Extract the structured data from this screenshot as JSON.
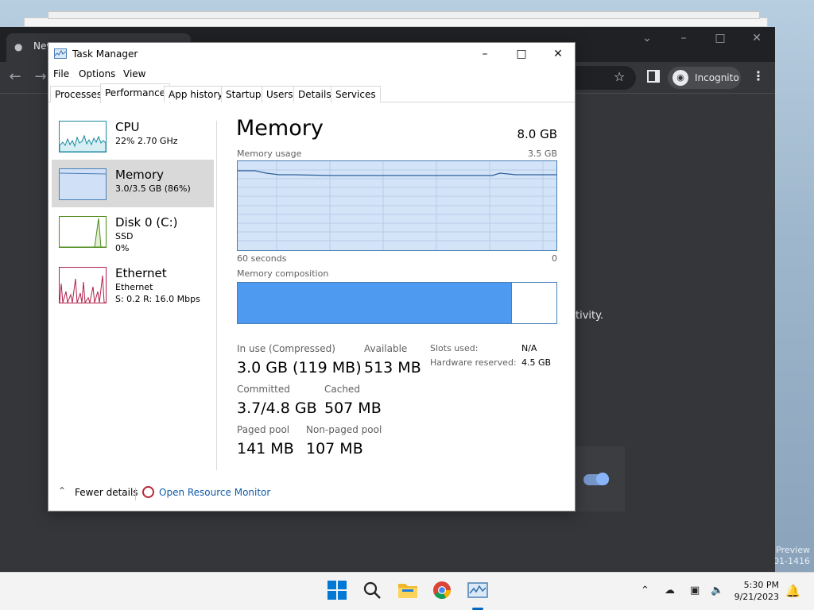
{
  "desktop": {
    "watermark_line1": "Preview",
    "watermark_line2": "001-1416"
  },
  "chrome": {
    "tab_title": "New",
    "incognito_label": "Incognito",
    "page_text_fragment": "tivity."
  },
  "task_manager": {
    "window_title": "Task Manager",
    "menu": [
      "File",
      "Options",
      "View"
    ],
    "tabs": [
      "Processes",
      "Performance",
      "App history",
      "Startup",
      "Users",
      "Details",
      "Services"
    ],
    "active_tab": "Performance",
    "resources": [
      {
        "name": "CPU",
        "line1": "22%  2.70 GHz",
        "line2": ""
      },
      {
        "name": "Memory",
        "line1": "3.0/3.5 GB (86%)",
        "line2": ""
      },
      {
        "name": "Disk 0 (C:)",
        "line1": "SSD",
        "line2": "0%"
      },
      {
        "name": "Ethernet",
        "line1": "Ethernet",
        "line2": "S: 0.2  R: 16.0 Mbps"
      }
    ],
    "memory": {
      "title": "Memory",
      "total": "8.0 GB",
      "usage_label": "Memory usage",
      "usage_max": "3.5 GB",
      "time_left": "60 seconds",
      "time_right": "0",
      "usage_fraction": 0.86,
      "composition_label": "Memory composition",
      "composition_in_use_fraction": 0.86,
      "in_use_label": "In use (Compressed)",
      "in_use_value": "3.0 GB (119 MB)",
      "available_label": "Available",
      "available_value": "513 MB",
      "committed_label": "Committed",
      "committed_value": "3.7/4.8 GB",
      "cached_label": "Cached",
      "cached_value": "507 MB",
      "paged_label": "Paged pool",
      "paged_value": "141 MB",
      "nonpaged_label": "Non-paged pool",
      "nonpaged_value": "107 MB",
      "slots_label": "Slots used:",
      "slots_value": "N/A",
      "hw_reserved_label": "Hardware reserved:",
      "hw_reserved_value": "4.5 GB"
    },
    "footer": {
      "fewer_details": "Fewer details",
      "open_resource_monitor": "Open Resource Monitor"
    }
  },
  "taskbar": {
    "time": "5:30 PM",
    "date": "9/21/2023",
    "icons": [
      "windows-start-icon",
      "search-icon",
      "file-explorer-icon",
      "chrome-icon",
      "task-manager-icon"
    ]
  },
  "colors": {
    "accent": "#0067c0",
    "memory_fill": "#4e9af0",
    "memory_graph_bg": "#d3e3f8",
    "memory_border": "#4a7fb5",
    "cpu_graph": "#1a8aa0",
    "disk_graph": "#4c8a1a",
    "ethernet_graph": "#b0204a"
  }
}
